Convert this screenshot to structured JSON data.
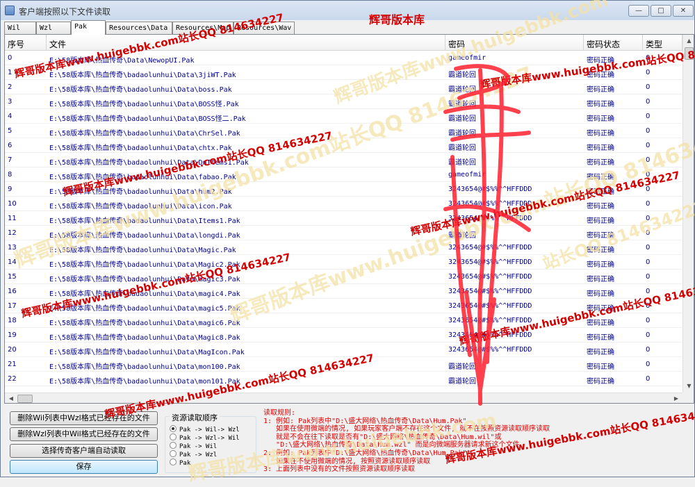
{
  "window": {
    "title": "客户端按照以下文件读取",
    "min_label": "—",
    "max_label": "□",
    "close_label": "✕"
  },
  "tabs": [
    "Wil",
    "Wzl",
    "Pak",
    "Resources\\Data",
    "Resources\\Map",
    "Resources\\Wav"
  ],
  "active_tab": "Pak",
  "table": {
    "headers": {
      "index": "序号",
      "file": "文件",
      "password": "密码",
      "status": "密码状态",
      "type": "类型"
    },
    "rows": [
      {
        "index": "0",
        "file": "E:\\58版本库\\热血传奇\\Data\\NewopUI.Pak",
        "password": "gameofmir",
        "status": "密码正确",
        "type": "0"
      },
      {
        "index": "1",
        "file": "E:\\58版本库\\热血传奇\\badaolunhui\\Data\\3jiWT.Pak",
        "password": "霸道轮回",
        "status": "密码正确",
        "type": "0"
      },
      {
        "index": "2",
        "file": "E:\\58版本库\\热血传奇\\badaolunhui\\Data\\boss.Pak",
        "password": "霸道轮回",
        "status": "密码正确",
        "type": "0"
      },
      {
        "index": "3",
        "file": "E:\\58版本库\\热血传奇\\badaolunhui\\Data\\BOSS怪.Pak",
        "password": "霸道轮回",
        "status": "密码正确",
        "type": "0"
      },
      {
        "index": "4",
        "file": "E:\\58版本库\\热血传奇\\badaolunhui\\Data\\BOSS怪二.Pak",
        "password": "霸道轮回",
        "status": "密码正确",
        "type": "0"
      },
      {
        "index": "5",
        "file": "E:\\58版本库\\热血传奇\\badaolunhui\\Data\\ChrSel.Pak",
        "password": "霸道轮回",
        "status": "密码正确",
        "type": "0"
      },
      {
        "index": "6",
        "file": "E:\\58版本库\\热血传奇\\badaolunhui\\Data\\chtx.Pak",
        "password": "霸道轮回",
        "status": "密码正确",
        "type": "0"
      },
      {
        "index": "7",
        "file": "E:\\58版本库\\热血传奇\\badaolunhui\\Data\\DnItems1.Pak",
        "password": "霸道轮回",
        "status": "密码正确",
        "type": "0"
      },
      {
        "index": "8",
        "file": "E:\\58版本库\\热血传奇\\badaolunhui\\Data\\fabao.Pak",
        "password": "gameofmir",
        "status": "密码正确",
        "type": "0"
      },
      {
        "index": "9",
        "file": "E:\\58版本库\\热血传奇\\badaolunhui\\Data\\hum2.Pak",
        "password": "3243654@#$%%^^HFFDDD",
        "status": "密码正确",
        "type": "0"
      },
      {
        "index": "10",
        "file": "E:\\58版本库\\热血传奇\\badaolunhui\\Data\\icon.Pak",
        "password": "3243654@#$%%^^HFFDDD",
        "status": "密码正确",
        "type": "0"
      },
      {
        "index": "11",
        "file": "E:\\58版本库\\热血传奇\\badaolunhui\\Data\\Items1.Pak",
        "password": "3243654@#$%%^^HFFDDD",
        "status": "密码正确",
        "type": "0"
      },
      {
        "index": "12",
        "file": "E:\\58版本库\\热血传奇\\badaolunhui\\Data\\longdi.Pak",
        "password": "霸道轮回",
        "status": "密码正确",
        "type": "0"
      },
      {
        "index": "13",
        "file": "E:\\58版本库\\热血传奇\\badaolunhui\\Data\\Magic.Pak",
        "password": "3243654@#$%%^^HFFDDD",
        "status": "密码正确",
        "type": "0"
      },
      {
        "index": "14",
        "file": "E:\\58版本库\\热血传奇\\badaolunhui\\Data\\Magic2.Pak",
        "password": "3243654@#$%%^^HFFDDD",
        "status": "密码正确",
        "type": "0"
      },
      {
        "index": "15",
        "file": "E:\\58版本库\\热血传奇\\badaolunhui\\Data\\magic3.Pak",
        "password": "3243654@#$%%^^HFFDDD",
        "status": "密码正确",
        "type": "0"
      },
      {
        "index": "16",
        "file": "E:\\58版本库\\热血传奇\\badaolunhui\\Data\\magic4.Pak",
        "password": "3243654@#$%%^^HFFDDD",
        "status": "密码正确",
        "type": "0"
      },
      {
        "index": "17",
        "file": "E:\\58版本库\\热血传奇\\badaolunhui\\Data\\magic5.Pak",
        "password": "3243654@#$%%^^HFFDDD",
        "status": "密码正确",
        "type": "0"
      },
      {
        "index": "18",
        "file": "E:\\58版本库\\热血传奇\\badaolunhui\\Data\\magic6.Pak",
        "password": "3243654@#$%%^^HFFDDD",
        "status": "密码正确",
        "type": "0"
      },
      {
        "index": "19",
        "file": "E:\\58版本库\\热血传奇\\badaolunhui\\Data\\Magic8.Pak",
        "password": "3243654@#$%%^^HFFDDD",
        "status": "密码正确",
        "type": "0"
      },
      {
        "index": "20",
        "file": "E:\\58版本库\\热血传奇\\badaolunhui\\Data\\MagIcon.Pak",
        "password": "3243654@#$%%^^HFFDDD",
        "status": "密码正确",
        "type": "0"
      },
      {
        "index": "21",
        "file": "E:\\58版本库\\热血传奇\\badaolunhui\\Data\\mon100.Pak",
        "password": "霸道轮回",
        "status": "密码正确",
        "type": "0"
      },
      {
        "index": "22",
        "file": "E:\\58版本库\\热血传奇\\badaolunhui\\Data\\mon101.Pak",
        "password": "霸道轮回",
        "status": "密码正确",
        "type": "0"
      }
    ]
  },
  "buttons": {
    "delete_wil": "删除Wil列表中Wzl格式已经存在的文件",
    "delete_wzl": "删除Wzl列表中Wil格式已经存在的文件",
    "auto_read": "选择传奇客户端自动读取",
    "save": "保存"
  },
  "resource_order": {
    "title": "资源读取顺序",
    "options": [
      "Pak -> Wil-> Wzl",
      "Pak -> Wzl-> Wil",
      "Pak -> Wil",
      "Pak -> Wzl",
      "Pak"
    ],
    "selected": 0
  },
  "rules": {
    "lines": [
      "读取规则:",
      "1: 例如: Pak列表中\"D:\\盛大网络\\热血传奇\\Data\\Hum.Pak\"",
      "   如果在使用微端的情况, 如果玩家客户端不存在这个文件, 就不在按照资源读取顺序读取",
      "   就是不会在往下读取是否有\"D:\\盛大网络\\热血传奇\\Data\\Hum.wil\"或",
      "   \"D:\\盛大网络\\热血传奇\\Data\\Hum.wzl\" 而是向微端服务器请求新这个文件",
      "2: 例如: Pak列表中\"D:\\盛大网络\\热血传奇\\Data\\Hum.Pak\"",
      "   如果在不使用微端的情况, 按照资源读取顺序读取",
      "3: 上面列表中没有的文件按照资源读取顺序读取"
    ]
  },
  "watermarks": {
    "site_qq": "辉哥版本库www.huigebbk.com站长QQ 814634227",
    "qq": "站长QQ 814634227",
    "site": "辉哥版本库www.huigebbk.com",
    "short": "辉哥版本库"
  },
  "colors": {
    "text_blue": "#00008b",
    "rules_red": "#e00000",
    "watermark": "#f4e2a8",
    "scribble": "#ff2030"
  }
}
